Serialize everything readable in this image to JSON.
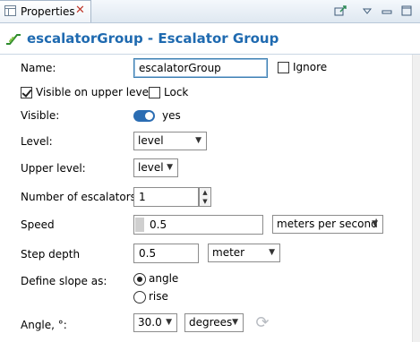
{
  "tab": {
    "title": "Properties",
    "close": "✕"
  },
  "toolbar": {
    "pin_icon": "pin-icon",
    "menu_icon": "view-menu-icon",
    "minimize": "▭",
    "maximize": "□"
  },
  "header": {
    "title": "escalatorGroup - Escalator Group",
    "icon": "escalator-icon"
  },
  "form": {
    "name": {
      "label": "Name:",
      "value": "escalatorGroup"
    },
    "ignore": {
      "label": "Ignore",
      "checked": false
    },
    "visible_upper": {
      "label": "Visible on upper level",
      "checked": true
    },
    "lock": {
      "label": "Lock",
      "checked": false
    },
    "visible": {
      "label": "Visible:",
      "value": "yes"
    },
    "level": {
      "label": "Level:",
      "value": "level"
    },
    "upper_level": {
      "label": "Upper level:",
      "value": "level"
    },
    "num_escalators": {
      "label": "Number of escalators:",
      "value": "1"
    },
    "speed": {
      "label": "Speed",
      "value": "0.5",
      "unit": "meters per second"
    },
    "step_depth": {
      "label": "Step depth",
      "value": "0.5",
      "unit": "meter"
    },
    "slope": {
      "label": "Define slope as:",
      "options": [
        "angle",
        "rise"
      ],
      "selected": "angle"
    },
    "angle": {
      "label": "Angle, °:",
      "value": "30.0",
      "unit": "degrees"
    }
  },
  "colors": {
    "accent": "#1f6ab0",
    "toggle": "#2b6db3"
  }
}
